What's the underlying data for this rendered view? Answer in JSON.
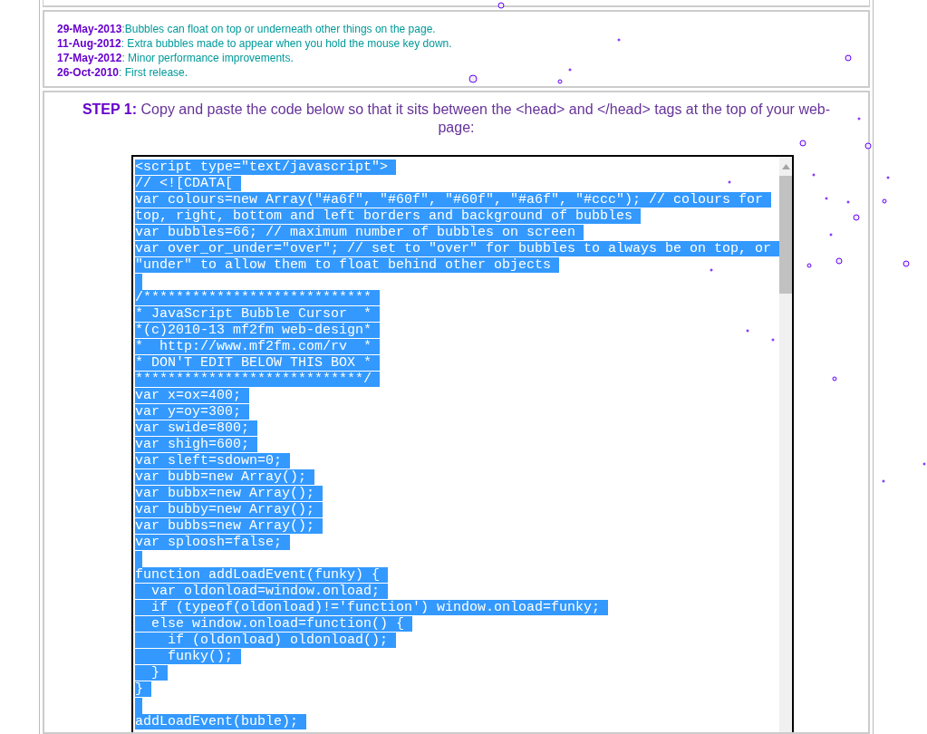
{
  "changelog": [
    {
      "date": "29-May-2013",
      "separator": ":",
      "text": "Bubbles can float on top or underneath other things on the page."
    },
    {
      "date": "11-Aug-2012",
      "separator": ": ",
      "text": "Extra bubbles made to appear when you hold the mouse key down."
    },
    {
      "date": "17-May-2012",
      "separator": ": ",
      "text": "Minor performance improvements."
    },
    {
      "date": "26-Oct-2010",
      "separator": ": ",
      "text": "First release."
    }
  ],
  "step": {
    "label": "STEP 1:",
    "text": "Copy and paste the code below so that it sits between the <head> and </head> tags at the top of your web-page:"
  },
  "code": {
    "selected": true,
    "lines": [
      {
        "kind": "text",
        "text": "<script type=\"text/javascript\">"
      },
      {
        "kind": "text",
        "text": "// <![CDATA["
      },
      {
        "kind": "text",
        "text": "var colours=new Array(\"#a6f\", \"#60f\", \"#60f\", \"#a6f\", \"#ccc\"); // colours for"
      },
      {
        "kind": "text",
        "text": "top, right, bottom and left borders and background of bubbles"
      },
      {
        "kind": "text",
        "text": "var bubbles=66; // maximum number of bubbles on screen"
      },
      {
        "kind": "text",
        "text": "var over_or_under=\"over\"; // set to \"over\" for bubbles to always be on top, or"
      },
      {
        "kind": "text",
        "text": "\"under\" to allow them to float behind other objects"
      },
      {
        "kind": "blank"
      },
      {
        "kind": "text",
        "text": "/****************************"
      },
      {
        "kind": "text",
        "text": "* JavaScript Bubble Cursor  *"
      },
      {
        "kind": "text",
        "text": "*(c)2010-13 mf2fm web-design*"
      },
      {
        "kind": "text",
        "text": "*  http://www.mf2fm.com/rv  *"
      },
      {
        "kind": "text",
        "text": "* DON'T EDIT BELOW THIS BOX *"
      },
      {
        "kind": "text",
        "text": "****************************/"
      },
      {
        "kind": "text",
        "text": "var x=ox=400;"
      },
      {
        "kind": "text",
        "text": "var y=oy=300;"
      },
      {
        "kind": "text",
        "text": "var swide=800;"
      },
      {
        "kind": "text",
        "text": "var shigh=600;"
      },
      {
        "kind": "text",
        "text": "var sleft=sdown=0;"
      },
      {
        "kind": "text",
        "text": "var bubb=new Array();"
      },
      {
        "kind": "text",
        "text": "var bubbx=new Array();"
      },
      {
        "kind": "text",
        "text": "var bubby=new Array();"
      },
      {
        "kind": "text",
        "text": "var bubbs=new Array();"
      },
      {
        "kind": "text",
        "text": "var sploosh=false;"
      },
      {
        "kind": "blank"
      },
      {
        "kind": "text",
        "text": "function addLoadEvent(funky) {"
      },
      {
        "kind": "text",
        "text": "  var oldonload=window.onload;"
      },
      {
        "kind": "text",
        "text": "  if (typeof(oldonload)!='function') window.onload=funky;"
      },
      {
        "kind": "text",
        "text": "  else window.onload=function() {"
      },
      {
        "kind": "text",
        "text": "    if (oldonload) oldonload();"
      },
      {
        "kind": "text",
        "text": "    funky();"
      },
      {
        "kind": "text",
        "text": "  }"
      },
      {
        "kind": "text",
        "text": "}"
      },
      {
        "kind": "blank"
      },
      {
        "kind": "text",
        "text": "addLoadEvent(buble);"
      }
    ]
  }
}
